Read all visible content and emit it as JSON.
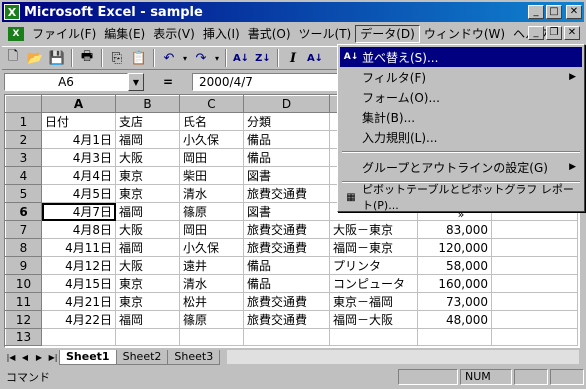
{
  "window": {
    "title": "Microsoft Excel - sample",
    "app_icon": "excel-icon"
  },
  "menu": [
    {
      "label": "ファイル(F)"
    },
    {
      "label": "編集(E)"
    },
    {
      "label": "表示(V)"
    },
    {
      "label": "挿入(I)"
    },
    {
      "label": "書式(O)"
    },
    {
      "label": "ツール(T)"
    },
    {
      "label": "データ(D)"
    },
    {
      "label": "ウィンドウ(W)"
    },
    {
      "label": "ヘルプ(H)"
    }
  ],
  "formula": {
    "name_box": "A6",
    "equals": "=",
    "value": "2000/4/7"
  },
  "columns": [
    "A",
    "B",
    "C",
    "D",
    "E",
    "F"
  ],
  "rows": [
    [
      "日付",
      "支店",
      "氏名",
      "分類",
      "",
      ""
    ],
    [
      "4月1日",
      "福岡",
      "小久保",
      "備品",
      "",
      ""
    ],
    [
      "4月3日",
      "大阪",
      "岡田",
      "備品",
      "",
      ""
    ],
    [
      "4月4日",
      "東京",
      "柴田",
      "図書",
      "",
      ""
    ],
    [
      "4月5日",
      "東京",
      "清水",
      "旅費交通費",
      "",
      ""
    ],
    [
      "4月7日",
      "福岡",
      "篠原",
      "図書",
      "",
      ""
    ],
    [
      "4月8日",
      "大阪",
      "岡田",
      "旅費交通費",
      "大阪－東京",
      "83,000"
    ],
    [
      "4月11日",
      "福岡",
      "小久保",
      "旅費交通費",
      "福岡－東京",
      "120,000"
    ],
    [
      "4月12日",
      "大阪",
      "遠井",
      "備品",
      "プリンタ",
      "58,000"
    ],
    [
      "4月15日",
      "東京",
      "清水",
      "備品",
      "コンピュータ",
      "160,000"
    ],
    [
      "4月21日",
      "東京",
      "松井",
      "旅費交通費",
      "東京－福岡",
      "73,000"
    ],
    [
      "4月22日",
      "福岡",
      "篠原",
      "旅費交通費",
      "福岡－大阪",
      "48,000"
    ],
    [
      "",
      "",
      "",
      "",
      "",
      ""
    ]
  ],
  "data_menu": {
    "items": [
      {
        "label": "並べ替え(S)...",
        "icon": "sort-icon"
      },
      {
        "label": "フィルタ(F)",
        "submenu": true
      },
      {
        "label": "フォーム(O)..."
      },
      {
        "label": "集計(B)..."
      },
      {
        "label": "入力規則(L)..."
      },
      {
        "label": "グループとアウトラインの設定(G)",
        "submenu": true
      },
      {
        "label": "ピボットテーブルとピボットグラフ レポート(P)...",
        "icon": "pivot-icon"
      }
    ],
    "more": "»"
  },
  "sheet_tabs": [
    "Sheet1",
    "Sheet2",
    "Sheet3"
  ],
  "status": {
    "mode": "コマンド",
    "num": "NUM"
  }
}
